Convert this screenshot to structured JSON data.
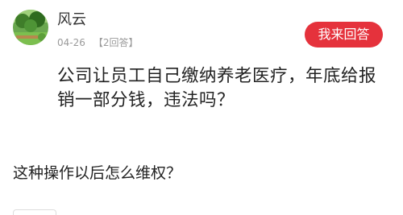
{
  "post": {
    "author_name": "风云",
    "date": "04-26",
    "answer_count": "【2回答】",
    "answer_button_label": "我来回答",
    "question": "公司让员工自己缴纳养老医疗，年底给报销一部分钱，违法吗？"
  },
  "sub_question": "这种操作以后怎么维权？",
  "colors": {
    "accent": "#e5323c",
    "meta_text": "#9a9a9a",
    "main_text": "#222222"
  },
  "icons": {
    "avatar": "landscape-avatar"
  }
}
